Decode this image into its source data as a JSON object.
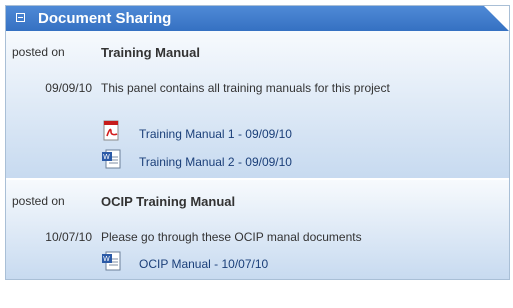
{
  "panel": {
    "title": "Document Sharing"
  },
  "posts": [
    {
      "posted_label": "posted on",
      "title": "Training Manual",
      "date": "09/09/10",
      "description": "This panel contains all training manuals for this project",
      "files": [
        {
          "icon": "pdf-icon",
          "label": "Training Manual 1 - 09/09/10"
        },
        {
          "icon": "word-doc-icon",
          "label": "Training Manual 2 - 09/09/10"
        }
      ]
    },
    {
      "posted_label": "posted on",
      "title": "OCIP Training Manual",
      "date": "10/07/10",
      "description": "Please go through these OCIP manal documents",
      "files": [
        {
          "icon": "word-doc-icon",
          "label": "OCIP Manual - 10/07/10"
        }
      ]
    }
  ],
  "colors": {
    "header": "#3a76c8",
    "link": "#1b3f79",
    "section_bottom": "#c7daf0"
  }
}
